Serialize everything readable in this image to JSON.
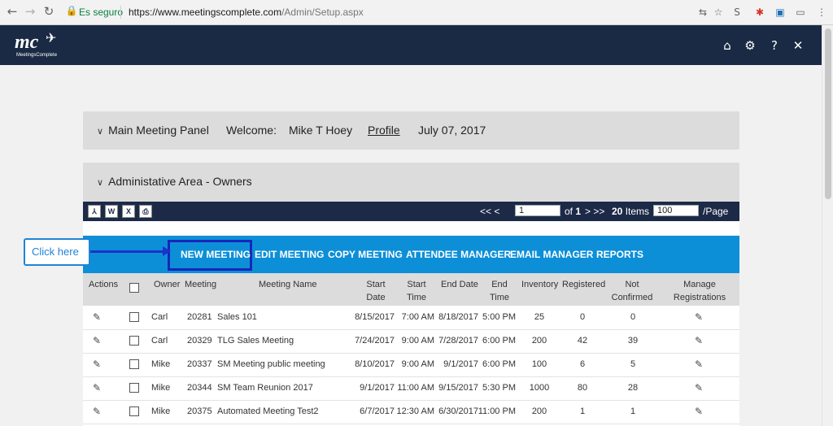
{
  "browser": {
    "secure_label": "Es seguro",
    "url_host": "https://www.meetingscomplete.com",
    "url_path": "/Admin/Setup.aspx"
  },
  "app": {
    "logo_text": "mc",
    "logo_brand": "MeetingsComplete"
  },
  "main_panel": {
    "title": "Main Meeting Panel",
    "welcome_label": "Welcome:",
    "user_name": "Mike T Hoey",
    "profile_link": "Profile",
    "date": "July 07, 2017"
  },
  "admin_panel": {
    "title": "Administative Area - Owners"
  },
  "grid_toolbar": {
    "export_icons": [
      "pdf-icon",
      "word-icon",
      "excel-icon",
      "print-icon"
    ],
    "first_prev": "<< <",
    "page_value": "1",
    "of_label": "of",
    "total_pages": "1",
    "next_last": "> >>",
    "items_count": "20",
    "items_label": "Items",
    "per_page_value": "100",
    "per_page_label": "/Page"
  },
  "action_bar": {
    "new_meeting": "NEW MEETING",
    "edit_meeting": "EDIT MEETING",
    "copy_meeting": "COPY MEETING",
    "attendee_manager": "ATTENDEE MANAGER",
    "email_manager": "EMAIL MANAGER",
    "reports": "REPORTS"
  },
  "callout": {
    "text": "Click here"
  },
  "table": {
    "headers": {
      "actions": "Actions",
      "owner": "Owner",
      "meeting": "Meeting",
      "meeting_name": "Meeting Name",
      "start_date_1": "Start",
      "start_date_2": "Date",
      "start_time_1": "Start",
      "start_time_2": "Time",
      "end_date": "End Date",
      "end_time_1": "End",
      "end_time_2": "Time",
      "inventory": "Inventory",
      "registered": "Registered",
      "not_confirmed_1": "Not",
      "not_confirmed_2": "Confirmed",
      "manage_reg_1": "Manage",
      "manage_reg_2": "Registrations"
    },
    "rows": [
      {
        "owner": "Carl",
        "meeting": "20281",
        "name": "Sales 101",
        "start_date": "8/15/2017",
        "start_time": "7:00 AM",
        "end_date": "8/18/2017",
        "end_time": "5:00 PM",
        "inventory": "25",
        "registered": "0",
        "not_confirmed": "0"
      },
      {
        "owner": "Carl",
        "meeting": "20329",
        "name": "TLG Sales Meeting",
        "start_date": "7/24/2017",
        "start_time": "9:00 AM",
        "end_date": "7/28/2017",
        "end_time": "6:00 PM",
        "inventory": "200",
        "registered": "42",
        "not_confirmed": "39"
      },
      {
        "owner": "Mike",
        "meeting": "20337",
        "name": "SM Meeting public meeting",
        "start_date": "8/10/2017",
        "start_time": "9:00 AM",
        "end_date": "9/1/2017",
        "end_time": "6:00 PM",
        "inventory": "100",
        "registered": "6",
        "not_confirmed": "5"
      },
      {
        "owner": "Mike",
        "meeting": "20344",
        "name": "SM Team Reunion 2017",
        "start_date": "9/1/2017",
        "start_time": "11:00 AM",
        "end_date": "9/15/2017",
        "end_time": "5:30 PM",
        "inventory": "1000",
        "registered": "80",
        "not_confirmed": "28"
      },
      {
        "owner": "Mike",
        "meeting": "20375",
        "name": "Automated Meeting Test2",
        "start_date": "6/7/2017",
        "start_time": "12:30 AM",
        "end_date": "6/30/2017",
        "end_time": "11:00 PM",
        "inventory": "200",
        "registered": "1",
        "not_confirmed": "1"
      }
    ]
  }
}
